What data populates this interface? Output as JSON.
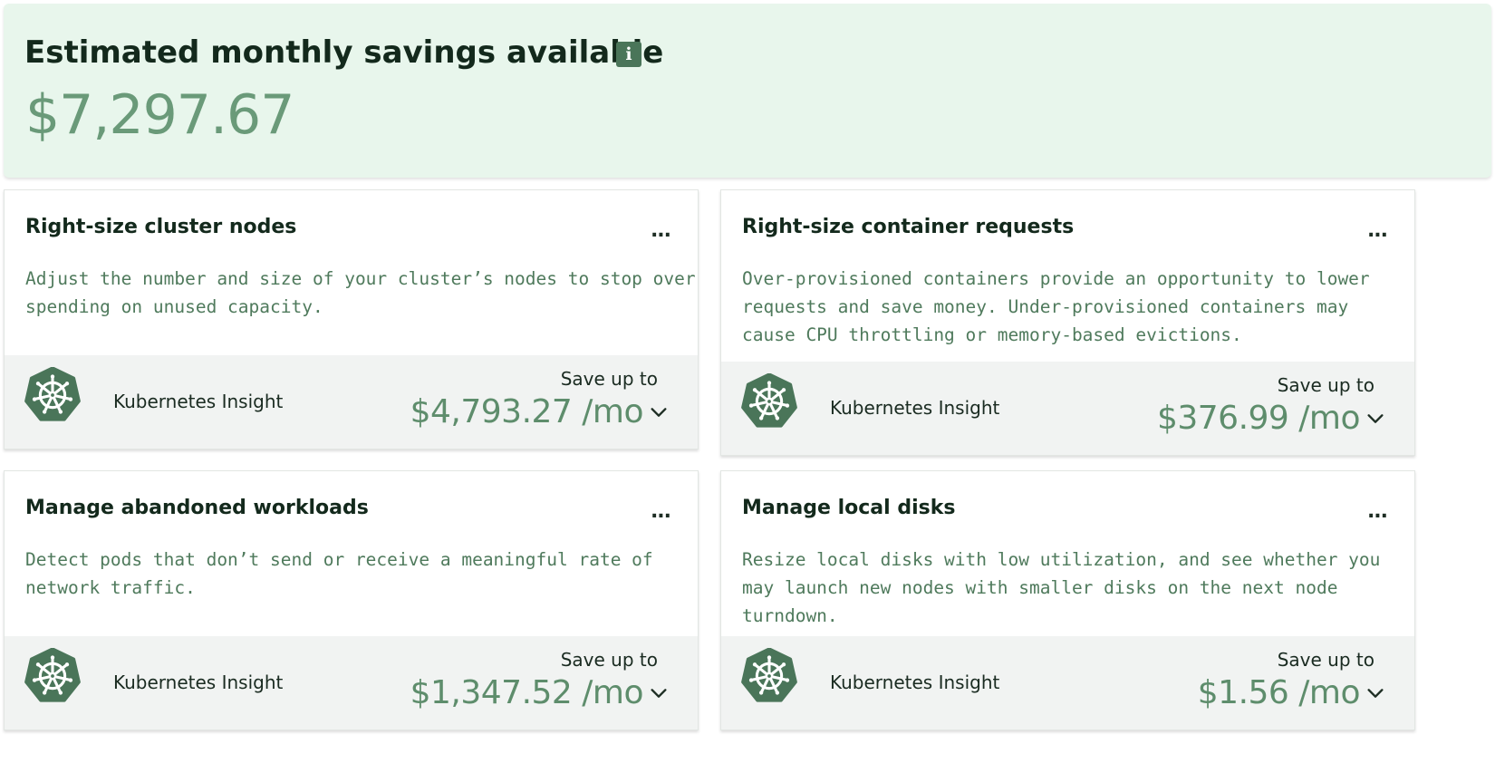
{
  "summary": {
    "title": "Estimated monthly savings available",
    "info_icon": "info-icon",
    "amount": "$7,297.67"
  },
  "cards": [
    {
      "title": "Right-size cluster nodes",
      "menu_label": "...",
      "description": "Adjust the number and size of your cluster’s nodes to stop over-spending on unused capacity.",
      "provider_icon": "kubernetes-icon",
      "provider": "Kubernetes Insight",
      "save_label": "Save up to",
      "save_amount": "$4,793.27 /mo"
    },
    {
      "title": "Right-size container requests",
      "menu_label": "...",
      "description": "Over-provisioned containers provide an opportunity to lower requests and save money. Under-provisioned containers may cause CPU throttling or memory-based evictions.",
      "provider_icon": "kubernetes-icon",
      "provider": "Kubernetes Insight",
      "save_label": "Save up to",
      "save_amount": "$376.99 /mo"
    },
    {
      "title": "Manage abandoned workloads",
      "menu_label": "...",
      "description": "Detect pods that don’t send or receive a meaningful rate of network traffic.",
      "provider_icon": "kubernetes-icon",
      "provider": "Kubernetes Insight",
      "save_label": "Save up to",
      "save_amount": "$1,347.52 /mo"
    },
    {
      "title": "Manage local disks",
      "menu_label": "...",
      "description": "Resize local disks with low utilization, and see whether you may launch new nodes with smaller disks on the next node turndown.",
      "provider_icon": "kubernetes-icon",
      "provider": "Kubernetes Insight",
      "save_label": "Save up to",
      "save_amount": "$1.56 /mo"
    }
  ],
  "colors": {
    "summary_bg": "#e8f6ec",
    "accent_green": "#5e8d6c",
    "logo_green": "#4a7559",
    "footer_bg": "#f1f3f2"
  }
}
